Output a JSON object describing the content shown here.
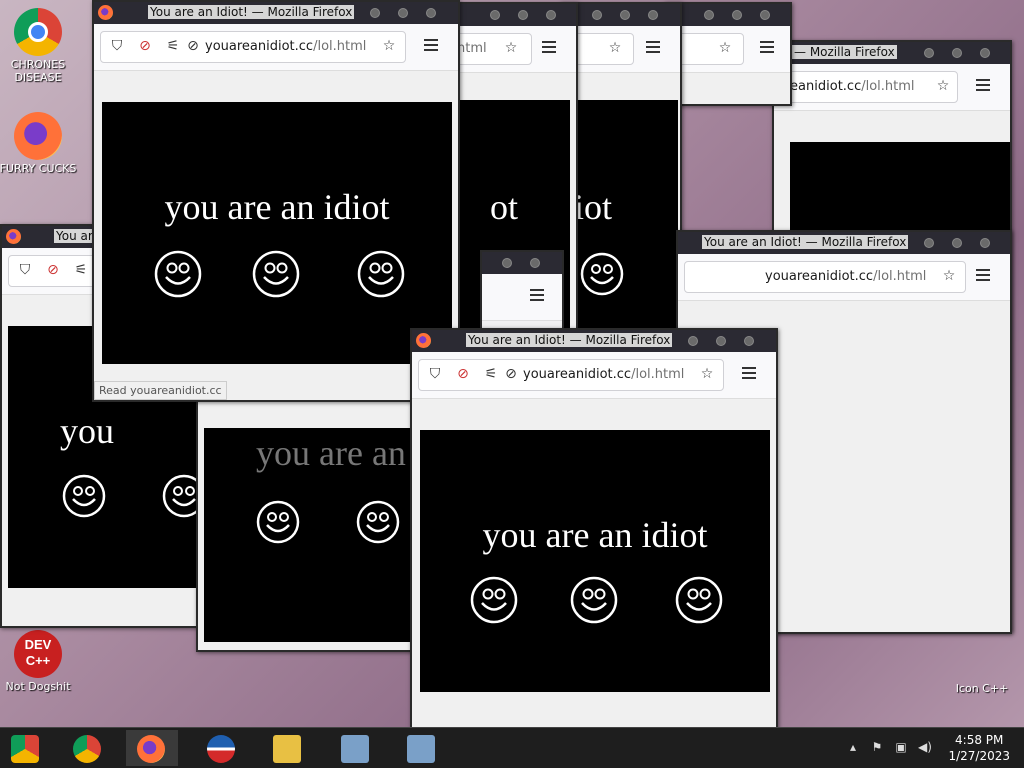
{
  "desktop": {
    "icons": [
      {
        "label": "CHRONES DISEASE",
        "icon": "chrome-icon"
      },
      {
        "label": "FURRY CUCKS",
        "icon": "firefox-icon"
      },
      {
        "label": "Not Dogshit",
        "icon": "devcpp-icon",
        "glyph": "DEV C++"
      },
      {
        "label": "Icon C++",
        "icon": "app-icon"
      }
    ]
  },
  "browser": {
    "title": "You are an Idiot! — Mozilla Firefox",
    "title_alt": "You are an Idiot! — Mozilla Firefox",
    "title_short": "You are",
    "title_frag": "— Mozilla Firefox",
    "url_domain": "youareanidiot.cc",
    "url_path": "/lol.html",
    "url_path_frag": "html",
    "url_domain_frag": "reanidiot.cc",
    "status": "Read youareanidiot.cc"
  },
  "page": {
    "message": "you are an idiot",
    "message_frag_you": "you",
    "message_frag_ot": "ot",
    "message_frag_liot": "liot",
    "message_frag_partial": "you are an"
  },
  "taskbar": {
    "apps": [
      "chrome-icon",
      "chrome-icon",
      "firefox-icon",
      "obama-icon",
      "file-explorer-icon",
      "installer-icon",
      "installer-icon"
    ],
    "time": "4:58 PM",
    "date": "1/27/2023"
  },
  "colors": {
    "titlebar": "#2b2a33",
    "page_bg": "#000000",
    "taskbar": "#1e1e1e"
  }
}
